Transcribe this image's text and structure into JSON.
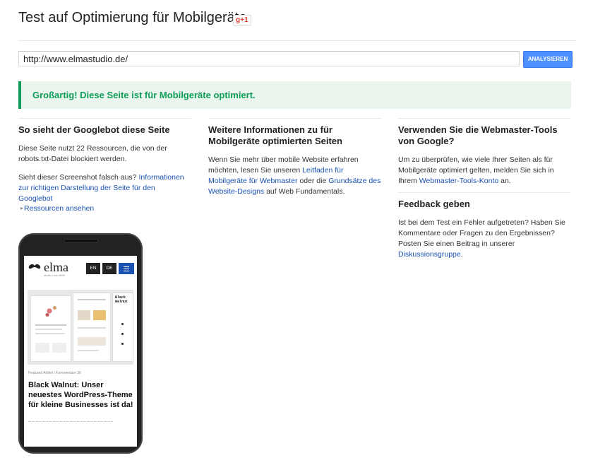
{
  "header": {
    "title": "Test auf Optimierung für Mobilgeräte",
    "gplus_label": "g+1"
  },
  "url_field": {
    "value": "http://www.elmastudio.de/",
    "button_label": "ANALYSIEREN"
  },
  "result": {
    "message": "Großartig! Diese Seite ist für Mobilgeräte optimiert."
  },
  "col1": {
    "heading": "So sieht der Googlebot diese Seite",
    "para1": "Diese Seite nutzt 22 Ressourcen, die von der robots.txt-Datei blockiert werden.",
    "para2_text": "Sieht dieser Screenshot falsch aus? ",
    "para2_link": "Informationen zur richtigen Darstellung der Seite für den Googlebot",
    "resources_link": "Ressourcen ansehen"
  },
  "col2": {
    "heading": "Weitere Informationen zu für Mobilgeräte optimierten Seiten",
    "text1": "Wenn Sie mehr über mobile Website erfahren möchten, lesen Sie unseren ",
    "link1": "Leitfaden für Mobilgeräte für Webmaster",
    "text2": " oder die ",
    "link2": "Grundsätze des Website-Designs",
    "text3": " auf Web Fundamentals."
  },
  "col3": {
    "heading": "Verwenden Sie die Webmaster-Tools von Google?",
    "text1": "Um zu überprüfen, wie viele Ihrer Seiten als für Mobilgeräte optimiert gelten, melden Sie sich in Ihrem ",
    "link1": "Webmaster-Tools-Konto",
    "text2": " an.",
    "heading2": "Feedback geben",
    "text3": "Ist bei dem Test ein Fehler aufgetreten? Haben Sie Kommentare oder Fragen zu den Ergebnissen? Posten Sie einen Beitrag in unserer ",
    "link2": "Diskussionsgruppe",
    "text4": "."
  },
  "phone": {
    "logo_text": "elma",
    "logo_sub": "studio • est 2008",
    "lang_en": "EN",
    "lang_de": "DE",
    "product_name_1": "Black",
    "product_name_2": "Walnut",
    "post_meta": "Featured Artikel / Kommentare 36",
    "post_title": "Black Walnut: Unser neuestes WordPress-Theme für kleine Businesses ist da!"
  },
  "colors": {
    "accent_blue": "#4d90fe",
    "link": "#1a52b4",
    "success_green": "#109d59"
  }
}
